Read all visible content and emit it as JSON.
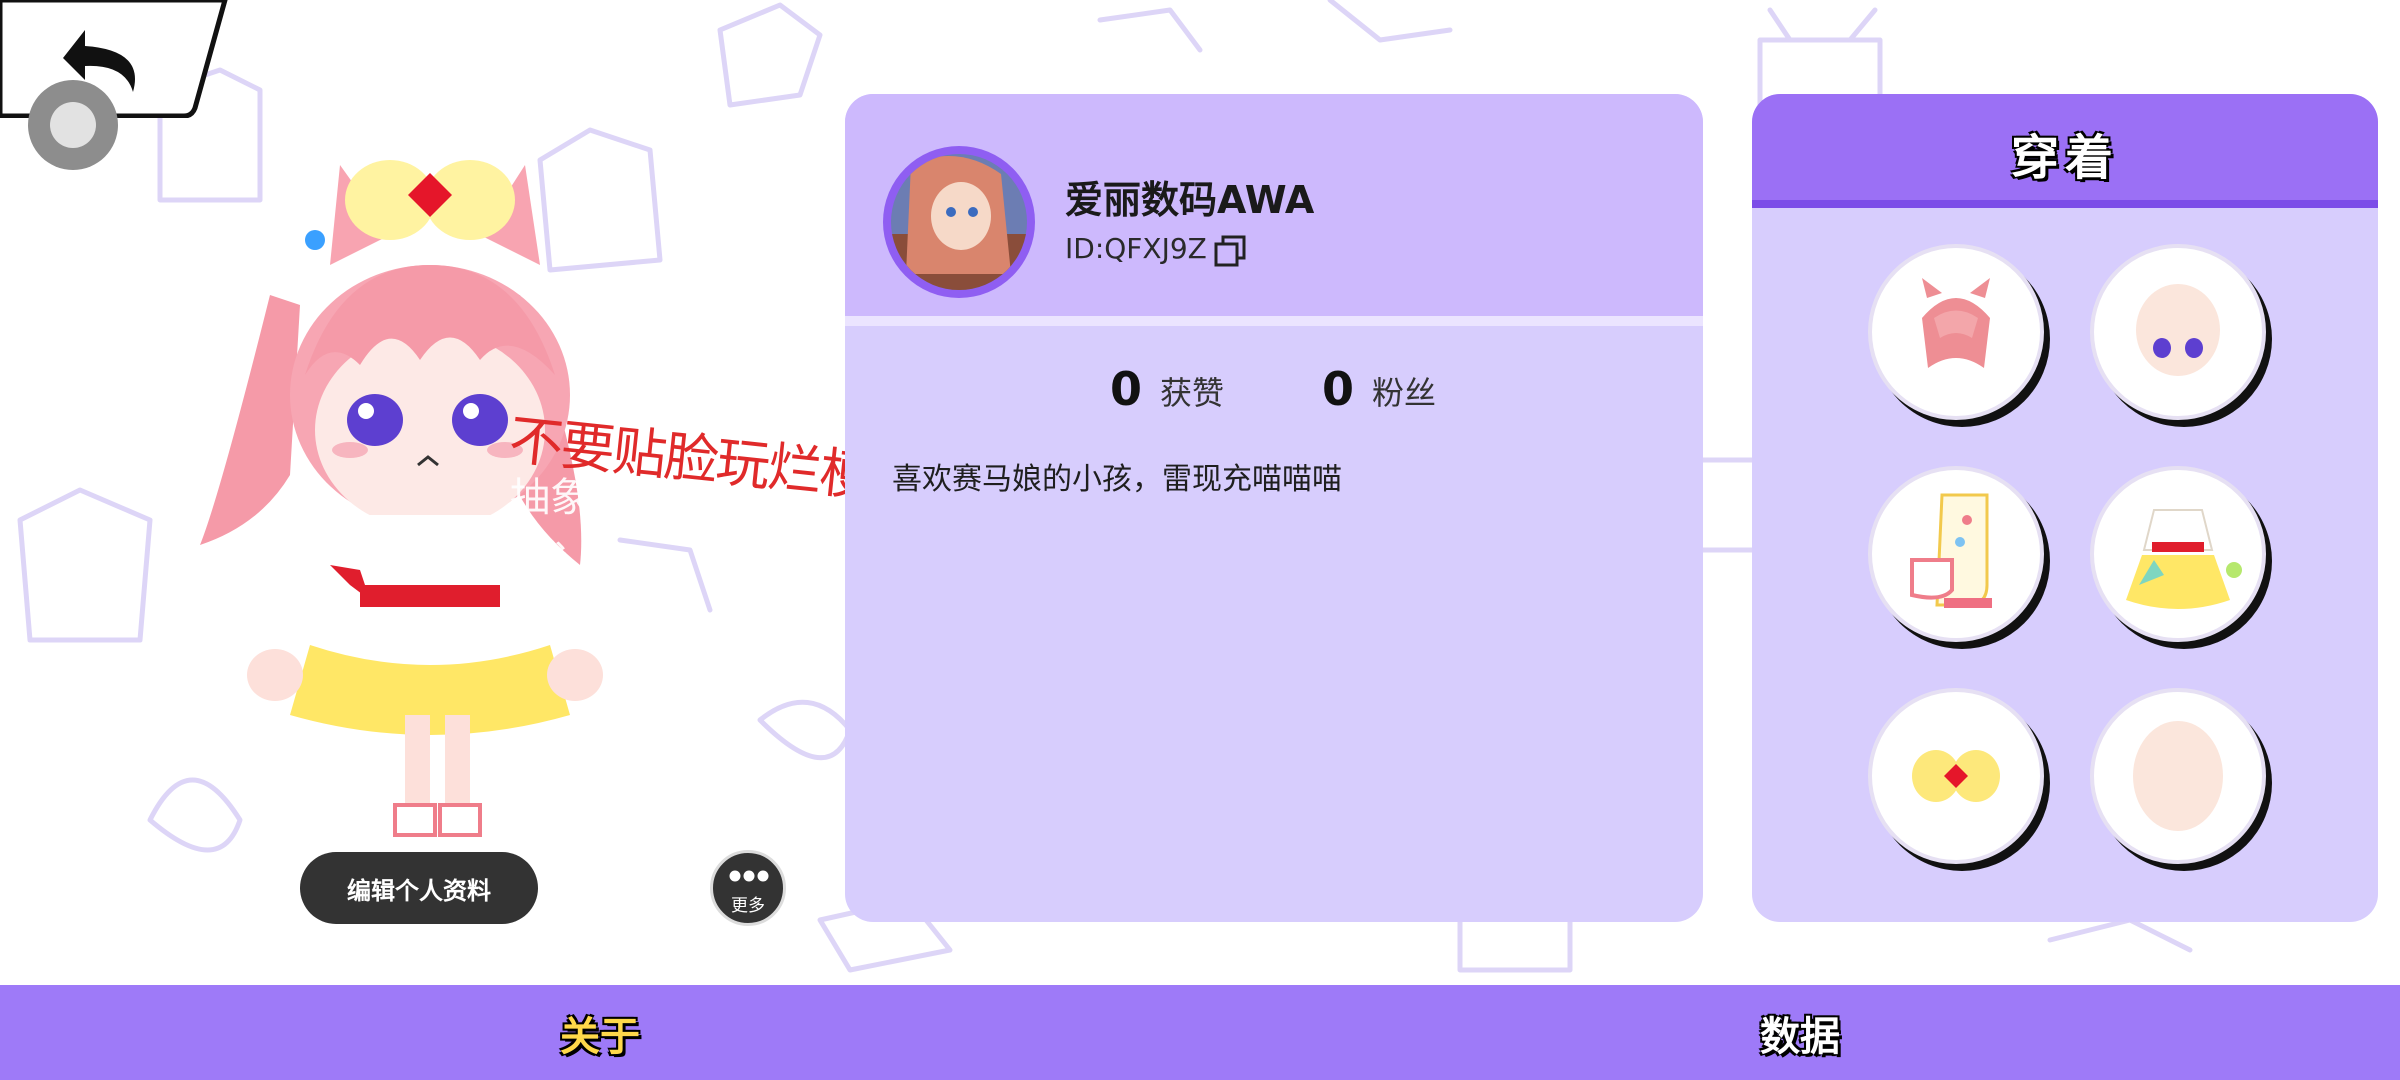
{
  "profile": {
    "username": "爱丽数码AWA",
    "user_id": "ID:QFXJ9Z",
    "likes_count": "0",
    "likes_label": "获赞",
    "fans_count": "0",
    "fans_label": "粉丝",
    "bio": "喜欢赛马娘的小孩，雷现充喵喵喵"
  },
  "avatar_overlay": {
    "danmu_line_1": "不要贴脸玩烂梗",
    "danmu_line_2": "抽象开",
    "danmu_line_3": "我"
  },
  "actions": {
    "edit_profile": "编辑个人资料",
    "more": "更多"
  },
  "outfit": {
    "title": "穿着",
    "slots": [
      "hair-icon",
      "face-icon",
      "shoes-icon",
      "dress-icon",
      "hair-accessory-icon",
      "head-base-icon"
    ]
  },
  "tabs": {
    "about": "关于",
    "data": "数据"
  },
  "colors": {
    "panel_bg": "#d7cdfd",
    "panel_header": "#cdb9fd",
    "outfit_header": "#9b70f5",
    "bottom_bar": "#9e7af8",
    "active_tab_text": "#ffd84a"
  }
}
